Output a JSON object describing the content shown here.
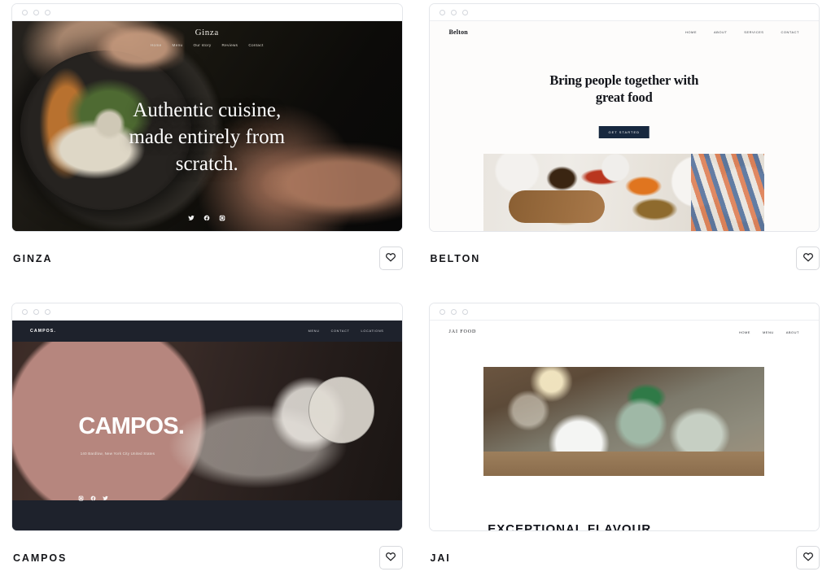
{
  "gallery": {
    "cards": [
      {
        "name": "ginza",
        "title": "GINZA",
        "favorite_icon": "heart-icon",
        "site": {
          "logo": "Ginza",
          "nav": [
            "Home",
            "Menu",
            "Our story",
            "Reviews",
            "Contact"
          ],
          "hero_line1": "Authentic cuisine,",
          "hero_line2": "made entirely from",
          "hero_line3": "scratch.",
          "social": [
            "twitter-icon",
            "facebook-icon",
            "instagram-icon"
          ]
        }
      },
      {
        "name": "belton",
        "title": "BELTON",
        "favorite_icon": "heart-icon",
        "site": {
          "logo": "Belton",
          "nav": [
            "HOME",
            "ABOUT",
            "SERVICES",
            "CONTACT"
          ],
          "hero_line1": "Bring people together with",
          "hero_line2": "great food",
          "button_label": "GET STARTED"
        }
      },
      {
        "name": "campos",
        "title": "CAMPOS",
        "favorite_icon": "heart-icon",
        "site": {
          "logo": "CAMPOS.",
          "nav": [
            "MENU",
            "CONTACT",
            "LOCATIONS"
          ],
          "hero_title": "CAMPOS.",
          "hero_sub": "140 Bardlow, New York City United States",
          "social": [
            "instagram-icon",
            "facebook-icon",
            "twitter-icon"
          ]
        }
      },
      {
        "name": "jai",
        "title": "JAI",
        "favorite_icon": "heart-icon",
        "site": {
          "logo": "JAI FOOD",
          "nav": [
            "HOME",
            "MENU",
            "ABOUT"
          ],
          "cut_heading": "EXCEPTIONAL FLAVOUR"
        }
      }
    ],
    "chrome_dots": 3,
    "colors": {
      "page_background": "#ffffff",
      "card_border": "#e4e6ea",
      "title_text": "#15161a",
      "campos_bar": "#1e222c",
      "belton_button": "#17283f"
    }
  }
}
